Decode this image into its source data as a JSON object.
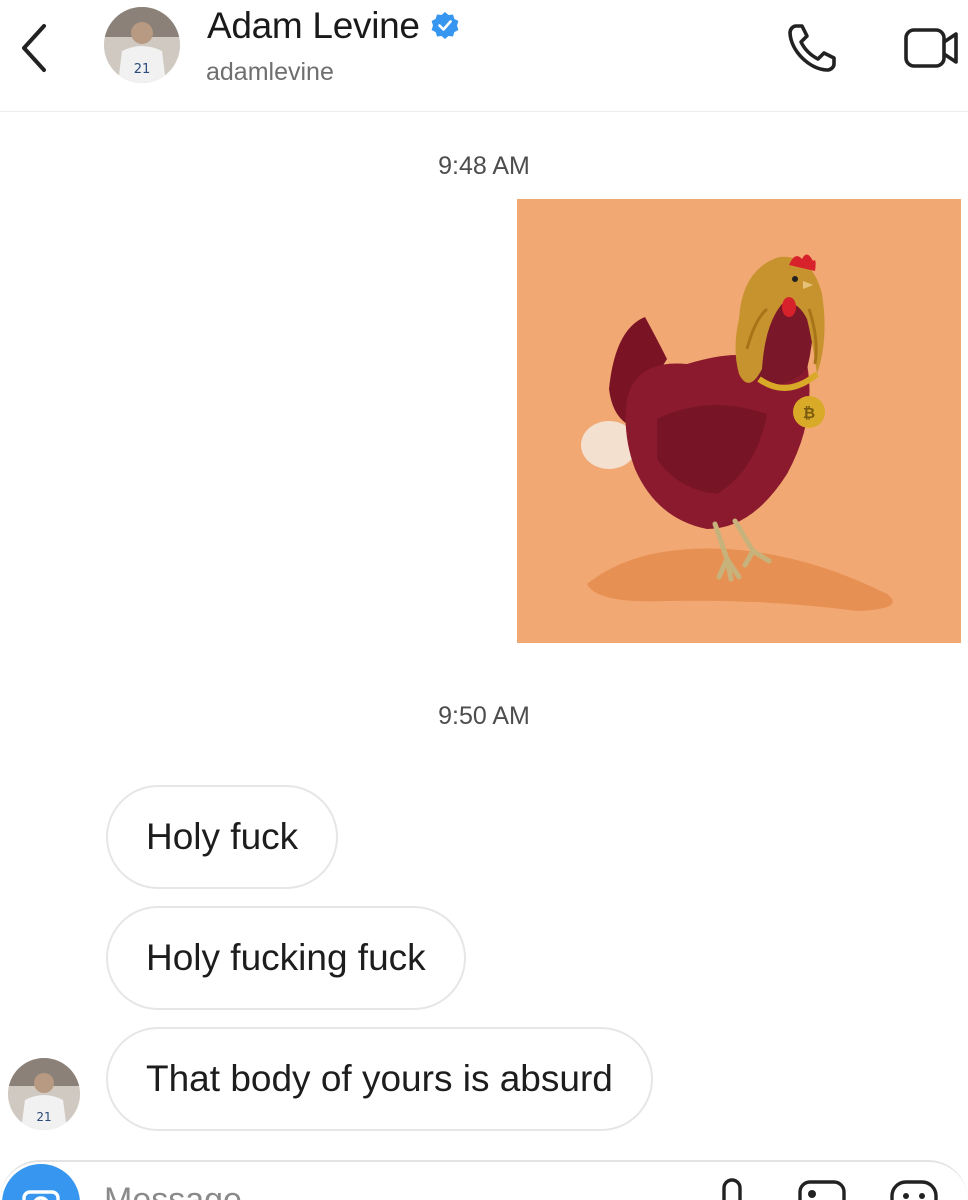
{
  "header": {
    "contact_name": "Adam Levine",
    "username": "adamlevine",
    "verified": true,
    "icons": [
      "back-chevron-icon",
      "avatar",
      "verified-badge-icon",
      "phone-icon",
      "video-camera-icon"
    ]
  },
  "conversation": {
    "messages": [
      {
        "type": "timestamp",
        "text": "9:48 AM"
      },
      {
        "type": "image",
        "sender": "me",
        "description_icon": "chicken-image"
      },
      {
        "type": "timestamp",
        "text": "9:50 AM"
      },
      {
        "type": "text",
        "sender": "them",
        "text": "Holy fuck"
      },
      {
        "type": "text",
        "sender": "them",
        "text": "Holy fucking fuck"
      },
      {
        "type": "text",
        "sender": "them",
        "text": "That body of yours is absurd"
      }
    ]
  },
  "composer": {
    "placeholder": "Message",
    "icons": [
      "camera-icon",
      "microphone-icon",
      "gallery-icon",
      "sticker-icon"
    ]
  },
  "colors": {
    "accent": "#3797f0",
    "image_background": "#f2a873",
    "bubble_border": "#e6e6e6"
  }
}
